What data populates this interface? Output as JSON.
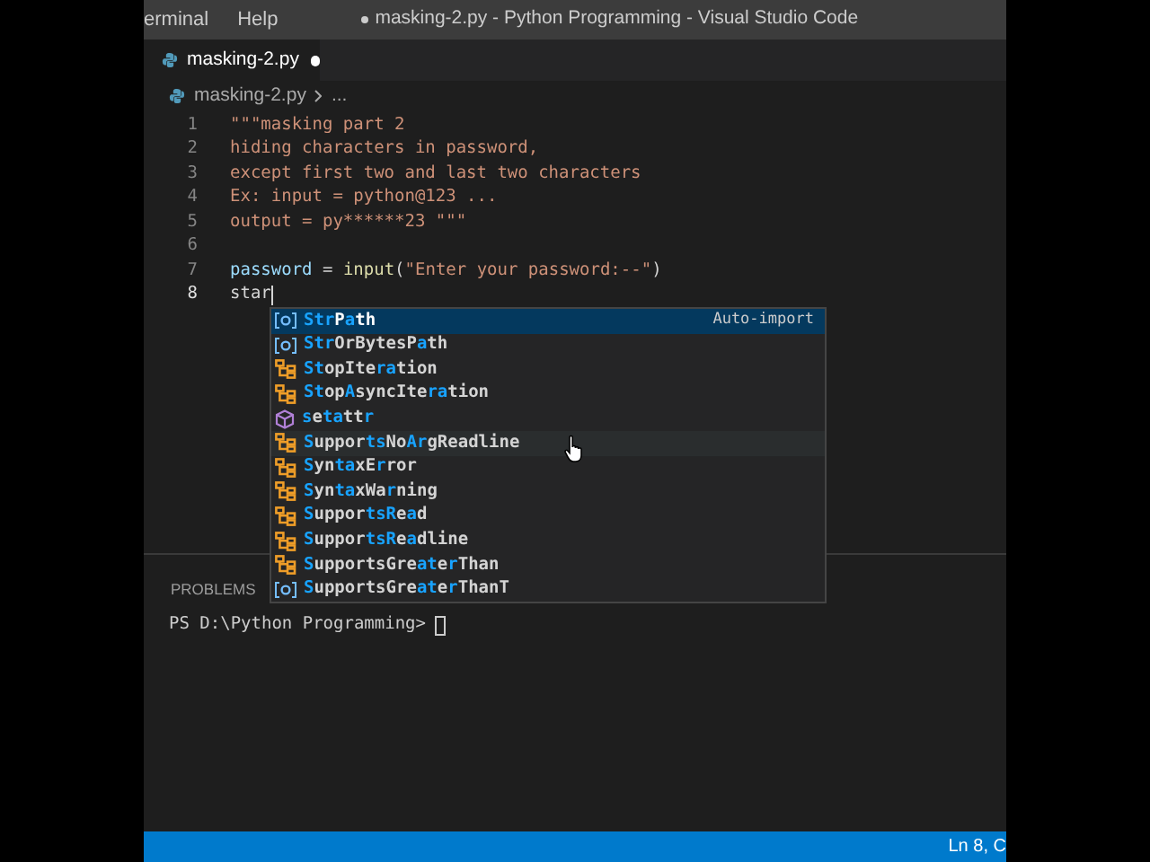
{
  "menu": [
    "erminal",
    "Help"
  ],
  "window": {
    "title": "masking-2.py - Python Programming - Visual Studio Code",
    "modified": true
  },
  "tab": {
    "label": "masking-2.py",
    "modified": true
  },
  "breadcrumb": {
    "file": "masking-2.py",
    "rest": "..."
  },
  "code_lines": [
    {
      "number": "1",
      "current": false,
      "tokens": [
        {
          "kind": "string",
          "text": "\"\"\"masking part 2"
        }
      ]
    },
    {
      "number": "2",
      "current": false,
      "tokens": [
        {
          "kind": "string",
          "text": "hiding characters in password,"
        }
      ]
    },
    {
      "number": "3",
      "current": false,
      "tokens": [
        {
          "kind": "string",
          "text": "except first two and last two characters"
        }
      ]
    },
    {
      "number": "4",
      "current": false,
      "tokens": [
        {
          "kind": "string",
          "text": "Ex: input = python@123 ..."
        }
      ]
    },
    {
      "number": "5",
      "current": false,
      "tokens": [
        {
          "kind": "string",
          "text": "output = py******23 \"\"\""
        }
      ]
    },
    {
      "number": "6",
      "current": false
    },
    {
      "number": "7",
      "current": false,
      "tokens": [
        {
          "kind": "variable",
          "text": "password"
        },
        {
          "kind": "plain",
          "text": " = "
        },
        {
          "kind": "function",
          "text": "input"
        },
        {
          "kind": "plain",
          "text": "("
        },
        {
          "kind": "string",
          "text": "\"Enter your password:--\""
        },
        {
          "kind": "plain",
          "text": ")"
        }
      ]
    },
    {
      "number": "8",
      "current": true,
      "tokens": [
        {
          "kind": "plain",
          "text": "star"
        }
      ]
    }
  ],
  "suggestions": [
    {
      "kind": "variable",
      "selected": true,
      "hovered": false,
      "detail": "Auto-import",
      "parts": [
        {
          "text": "Str",
          "match": true
        },
        {
          "text": "P",
          "match": false
        },
        {
          "text": "a",
          "match": true
        },
        {
          "text": "th",
          "match": false
        }
      ]
    },
    {
      "kind": "variable",
      "selected": false,
      "hovered": false,
      "parts": [
        {
          "text": "Str",
          "match": true
        },
        {
          "text": "OrBytesP",
          "match": false
        },
        {
          "text": "a",
          "match": true
        },
        {
          "text": "th",
          "match": false
        }
      ]
    },
    {
      "kind": "class",
      "selected": false,
      "hovered": false,
      "parts": [
        {
          "text": "St",
          "match": true
        },
        {
          "text": "opIte",
          "match": false
        },
        {
          "text": "ra",
          "match": true
        },
        {
          "text": "tion",
          "match": false
        }
      ]
    },
    {
      "kind": "class",
      "selected": false,
      "hovered": false,
      "parts": [
        {
          "text": "St",
          "match": true
        },
        {
          "text": "op",
          "match": false
        },
        {
          "text": "A",
          "match": true
        },
        {
          "text": "syncIte",
          "match": false
        },
        {
          "text": "ra",
          "match": true
        },
        {
          "text": "tion",
          "match": false
        }
      ]
    },
    {
      "kind": "function",
      "selected": false,
      "hovered": false,
      "parts": [
        {
          "text": "s",
          "match": true
        },
        {
          "text": "e",
          "match": false
        },
        {
          "text": "ta",
          "match": true
        },
        {
          "text": "tt",
          "match": false
        },
        {
          "text": "r",
          "match": true
        }
      ]
    },
    {
      "kind": "class",
      "selected": false,
      "hovered": true,
      "parts": [
        {
          "text": "S",
          "match": true
        },
        {
          "text": "uppor",
          "match": false
        },
        {
          "text": "ts",
          "match": true
        },
        {
          "text": "No",
          "match": false
        },
        {
          "text": "Ar",
          "match": true
        },
        {
          "text": "gReadline",
          "match": false
        }
      ]
    },
    {
      "kind": "class",
      "selected": false,
      "hovered": false,
      "parts": [
        {
          "text": "S",
          "match": true
        },
        {
          "text": "yn",
          "match": false
        },
        {
          "text": "ta",
          "match": true
        },
        {
          "text": "xE",
          "match": false
        },
        {
          "text": "r",
          "match": true
        },
        {
          "text": "ror",
          "match": false
        }
      ]
    },
    {
      "kind": "class",
      "selected": false,
      "hovered": false,
      "parts": [
        {
          "text": "S",
          "match": true
        },
        {
          "text": "yn",
          "match": false
        },
        {
          "text": "ta",
          "match": true
        },
        {
          "text": "xWa",
          "match": false
        },
        {
          "text": "r",
          "match": true
        },
        {
          "text": "ning",
          "match": false
        }
      ]
    },
    {
      "kind": "class",
      "selected": false,
      "hovered": false,
      "parts": [
        {
          "text": "S",
          "match": true
        },
        {
          "text": "uppor",
          "match": false
        },
        {
          "text": "tsR",
          "match": true
        },
        {
          "text": "e",
          "match": false
        },
        {
          "text": "a",
          "match": true
        },
        {
          "text": "d",
          "match": false
        }
      ]
    },
    {
      "kind": "class",
      "selected": false,
      "hovered": false,
      "parts": [
        {
          "text": "S",
          "match": true
        },
        {
          "text": "uppor",
          "match": false
        },
        {
          "text": "tsR",
          "match": true
        },
        {
          "text": "e",
          "match": false
        },
        {
          "text": "a",
          "match": true
        },
        {
          "text": "dline",
          "match": false
        }
      ]
    },
    {
      "kind": "class",
      "selected": false,
      "hovered": false,
      "parts": [
        {
          "text": "S",
          "match": true
        },
        {
          "text": "upportsGre",
          "match": false
        },
        {
          "text": "at",
          "match": true
        },
        {
          "text": "e",
          "match": false
        },
        {
          "text": "r",
          "match": true
        },
        {
          "text": "Than",
          "match": false
        }
      ]
    },
    {
      "kind": "variable",
      "selected": false,
      "hovered": false,
      "parts": [
        {
          "text": "S",
          "match": true
        },
        {
          "text": "upportsGre",
          "match": false
        },
        {
          "text": "at",
          "match": true
        },
        {
          "text": "e",
          "match": false
        },
        {
          "text": "r",
          "match": true
        },
        {
          "text": "ThanT",
          "match": false
        }
      ]
    }
  ],
  "panel": {
    "tab": "PROBLEMS",
    "terminal_prompt": "PS D:\\Python Programming>"
  },
  "status_bar": {
    "position": "Ln 8, C"
  }
}
